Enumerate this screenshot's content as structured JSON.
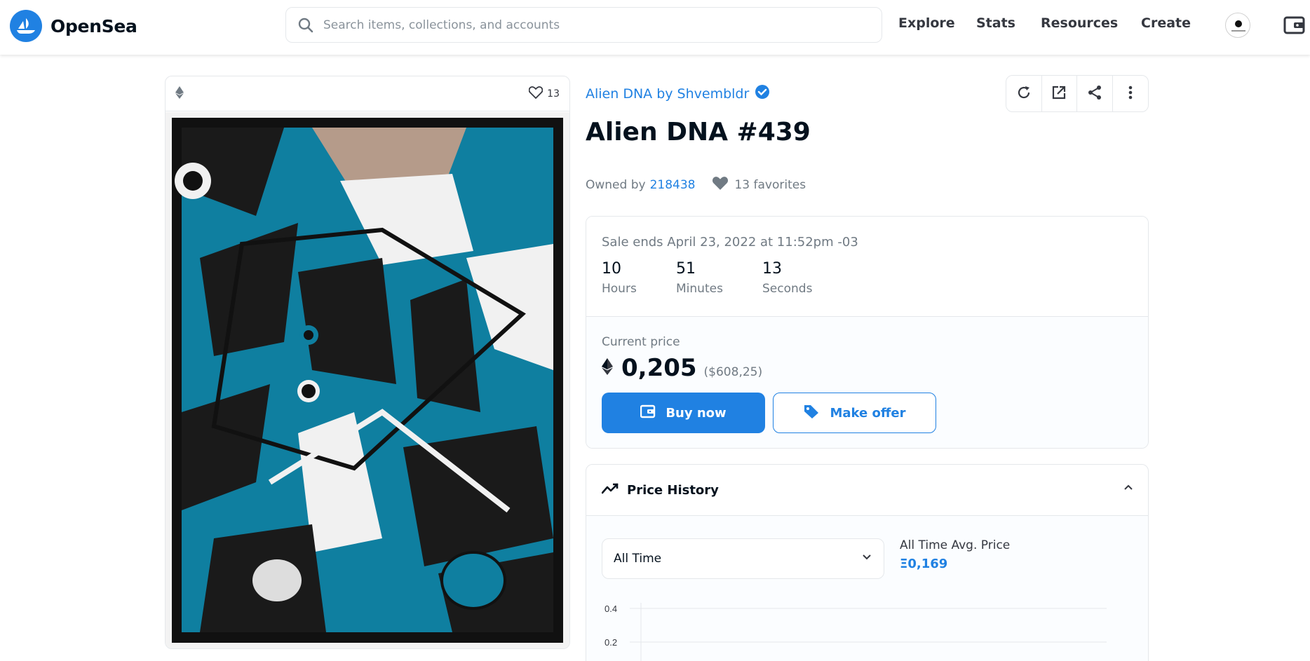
{
  "header": {
    "brand": "OpenSea",
    "search_placeholder": "Search items, collections, and accounts",
    "nav": [
      "Explore",
      "Stats",
      "Resources",
      "Create"
    ]
  },
  "art": {
    "favorites_count": "13"
  },
  "item": {
    "collection": "Alien DNA by Shvembldr",
    "title": "Alien DNA #439",
    "owned_by_label": "Owned by",
    "owner": "218438",
    "favorites": "13 favorites"
  },
  "sale": {
    "ends": "Sale ends April 23, 2022 at 11:52pm -03",
    "countdown": [
      {
        "value": "10",
        "label": "Hours"
      },
      {
        "value": "51",
        "label": "Minutes"
      },
      {
        "value": "13",
        "label": "Seconds"
      }
    ],
    "current_price_label": "Current price",
    "price": "0,205",
    "price_usd": "($608,25)",
    "buy_label": "Buy now",
    "offer_label": "Make offer"
  },
  "price_history": {
    "title": "Price History",
    "period": "All Time",
    "avg_label": "All Time Avg. Price",
    "avg_value": "Ξ0,169",
    "y_ticks": [
      "0.4",
      "0.2"
    ]
  },
  "colors": {
    "brand_blue": "#2081e2",
    "art_teal": "#0f7fa0"
  }
}
